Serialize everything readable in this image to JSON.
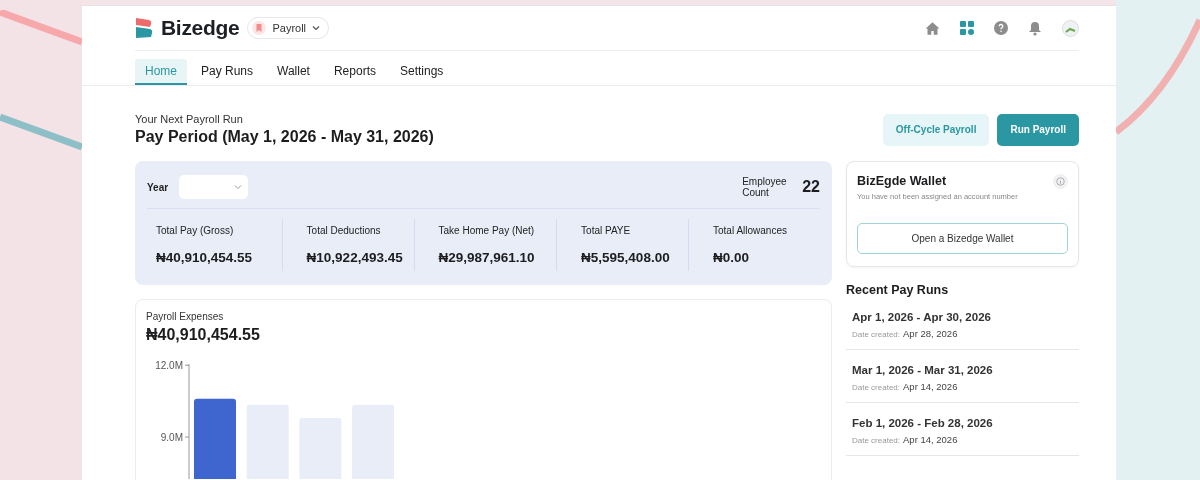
{
  "logo": {
    "text": "Bizedge"
  },
  "app_switcher": {
    "label": "Payroll"
  },
  "tabs": [
    {
      "label": "Home",
      "selected": true
    },
    {
      "label": "Pay Runs",
      "selected": false
    },
    {
      "label": "Wallet",
      "selected": false
    },
    {
      "label": "Reports",
      "selected": false
    },
    {
      "label": "Settings",
      "selected": false
    }
  ],
  "next_run": {
    "caption": "Your Next Payroll Run",
    "title": "Pay Period (May 1, 2026 - May 31, 2026)"
  },
  "actions": [
    {
      "label": "Off-Cycle Payroll",
      "kind": "secondary"
    },
    {
      "label": "Run Payroll",
      "kind": "primary"
    }
  ],
  "summary": {
    "year_label": "Year",
    "employee_count_label": "Employee Count",
    "employee_count": "22",
    "stats": [
      {
        "label": "Total Pay (Gross)",
        "value": "₦40,910,454.55"
      },
      {
        "label": "Total Deductions",
        "value": "₦10,922,493.45"
      },
      {
        "label": "Take Home Pay (Net)",
        "value": "₦29,987,961.10"
      },
      {
        "label": "Total PAYE",
        "value": "₦5,595,408.00"
      },
      {
        "label": "Total Allowances",
        "value": "₦0.00"
      }
    ]
  },
  "expenses": {
    "title": "Payroll Expenses",
    "total": "₦40,910,454.55",
    "chart_data": {
      "type": "bar",
      "categories": [
        null,
        null,
        null,
        null
      ],
      "stacked": true,
      "ylim": [
        7.25,
        12.05
      ],
      "yticks": [
        {
          "value": 9,
          "label": "9.0M"
        },
        {
          "value": 12,
          "label": "12.0M"
        }
      ],
      "series": [
        {
          "color": "#3f66cf",
          "values": [
            10.6,
            null,
            null,
            null
          ]
        },
        {
          "color": "#e8edf8",
          "values": [
            null,
            10.35,
            9.8,
            10.35
          ]
        }
      ]
    }
  },
  "wallet": {
    "title": "BizEgde Wallet",
    "subtitle": "You have not been assigned an account number",
    "button": "Open a Bizedge Wallet"
  },
  "recent_pay_runs": {
    "title": "Recent Pay Runs",
    "items": [
      {
        "period": "Apr 1, 2026 - Apr 30, 2026",
        "created_label": "Date created:",
        "created": "Apr 28, 2026"
      },
      {
        "period": "Mar 1, 2026 - Mar 31, 2026",
        "created_label": "Date created:",
        "created": "Apr 14, 2026"
      },
      {
        "period": "Feb 1, 2026 - Feb 28, 2026",
        "created_label": "Date created:",
        "created": "Apr 14, 2026"
      }
    ]
  }
}
